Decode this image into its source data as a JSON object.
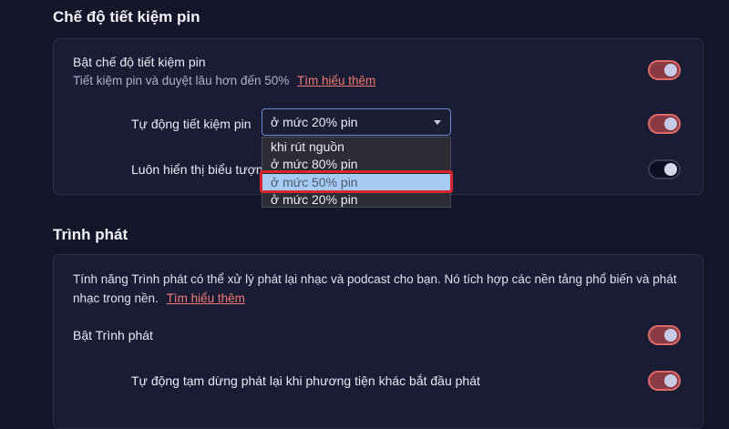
{
  "battery": {
    "section_title": "Chế độ tiết kiệm pin",
    "enable_label": "Bật chế độ tiết kiệm pin",
    "enable_desc": "Tiết kiệm pin và duyệt lâu hơn đến 50%",
    "learn_more": "Tìm hiểu thêm",
    "auto_label": "Tự động tiết kiệm pin",
    "auto_value": "ở mức 20% pin",
    "always_show_label": "Luôn hiển thị biểu tượng",
    "options": [
      "khi rút nguồn",
      "ở mức 80% pin",
      "ở mức 50% pin",
      "ở mức 20% pin"
    ],
    "enable_on": true,
    "auto_on": true,
    "always_show_on": false
  },
  "player": {
    "section_title": "Trình phát",
    "desc_line1": "Tính năng Trình phát có thể xử lý phát lại nhạc và podcast cho bạn. Nó tích hợp các nền tảng phổ biến và phát",
    "desc_line2": "nhạc trong nền.",
    "learn_more": "Tìm hiểu thêm",
    "enable_label": "Bật Trình phát",
    "auto_pause_label": "Tự động tạm dừng phát lại khi phương tiện khác bắt đầu phát",
    "enable_on": true,
    "auto_pause_on": true
  },
  "colors": {
    "background": "#141529",
    "card": "#1a1c33",
    "toggle_on_border": "#e06a66",
    "link": "#f07a73",
    "highlight_box": "#d9262e",
    "option_selected": "#a6cbf4"
  }
}
